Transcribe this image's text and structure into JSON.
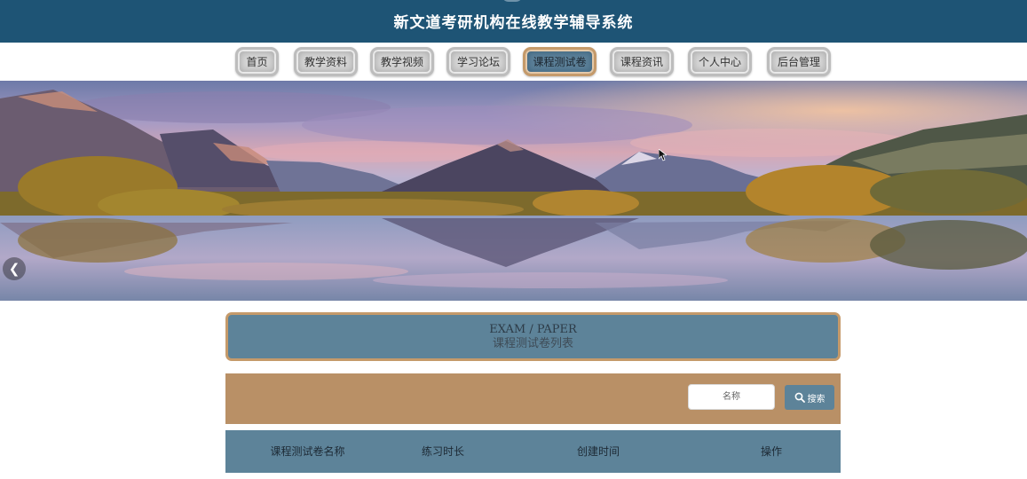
{
  "header": {
    "title": "新文道考研机构在线教学辅导系统"
  },
  "nav": {
    "items": [
      {
        "label": "首页",
        "active": false
      },
      {
        "label": "教学资料",
        "active": false
      },
      {
        "label": "教学视频",
        "active": false
      },
      {
        "label": "学习论坛",
        "active": false
      },
      {
        "label": "课程测试卷",
        "active": true
      },
      {
        "label": "课程资讯",
        "active": false
      },
      {
        "label": "个人中心",
        "active": false
      },
      {
        "label": "后台管理",
        "active": false
      }
    ]
  },
  "banner": {
    "image": "mountain-lake-landscape",
    "prev_icon": "chevron-left-icon"
  },
  "section": {
    "title_en": "EXAM / PAPER",
    "title_cn": "课程测试卷列表"
  },
  "search": {
    "placeholder": "名称",
    "button_label": "搜索",
    "button_icon": "search-icon"
  },
  "table": {
    "columns": [
      "课程测试卷名称",
      "练习时长",
      "创建时间",
      "操作"
    ]
  },
  "colors": {
    "header_bg": "#1e5475",
    "accent_blue": "#5d8399",
    "accent_tan": "#b99066",
    "active_border": "#c59a6a"
  }
}
